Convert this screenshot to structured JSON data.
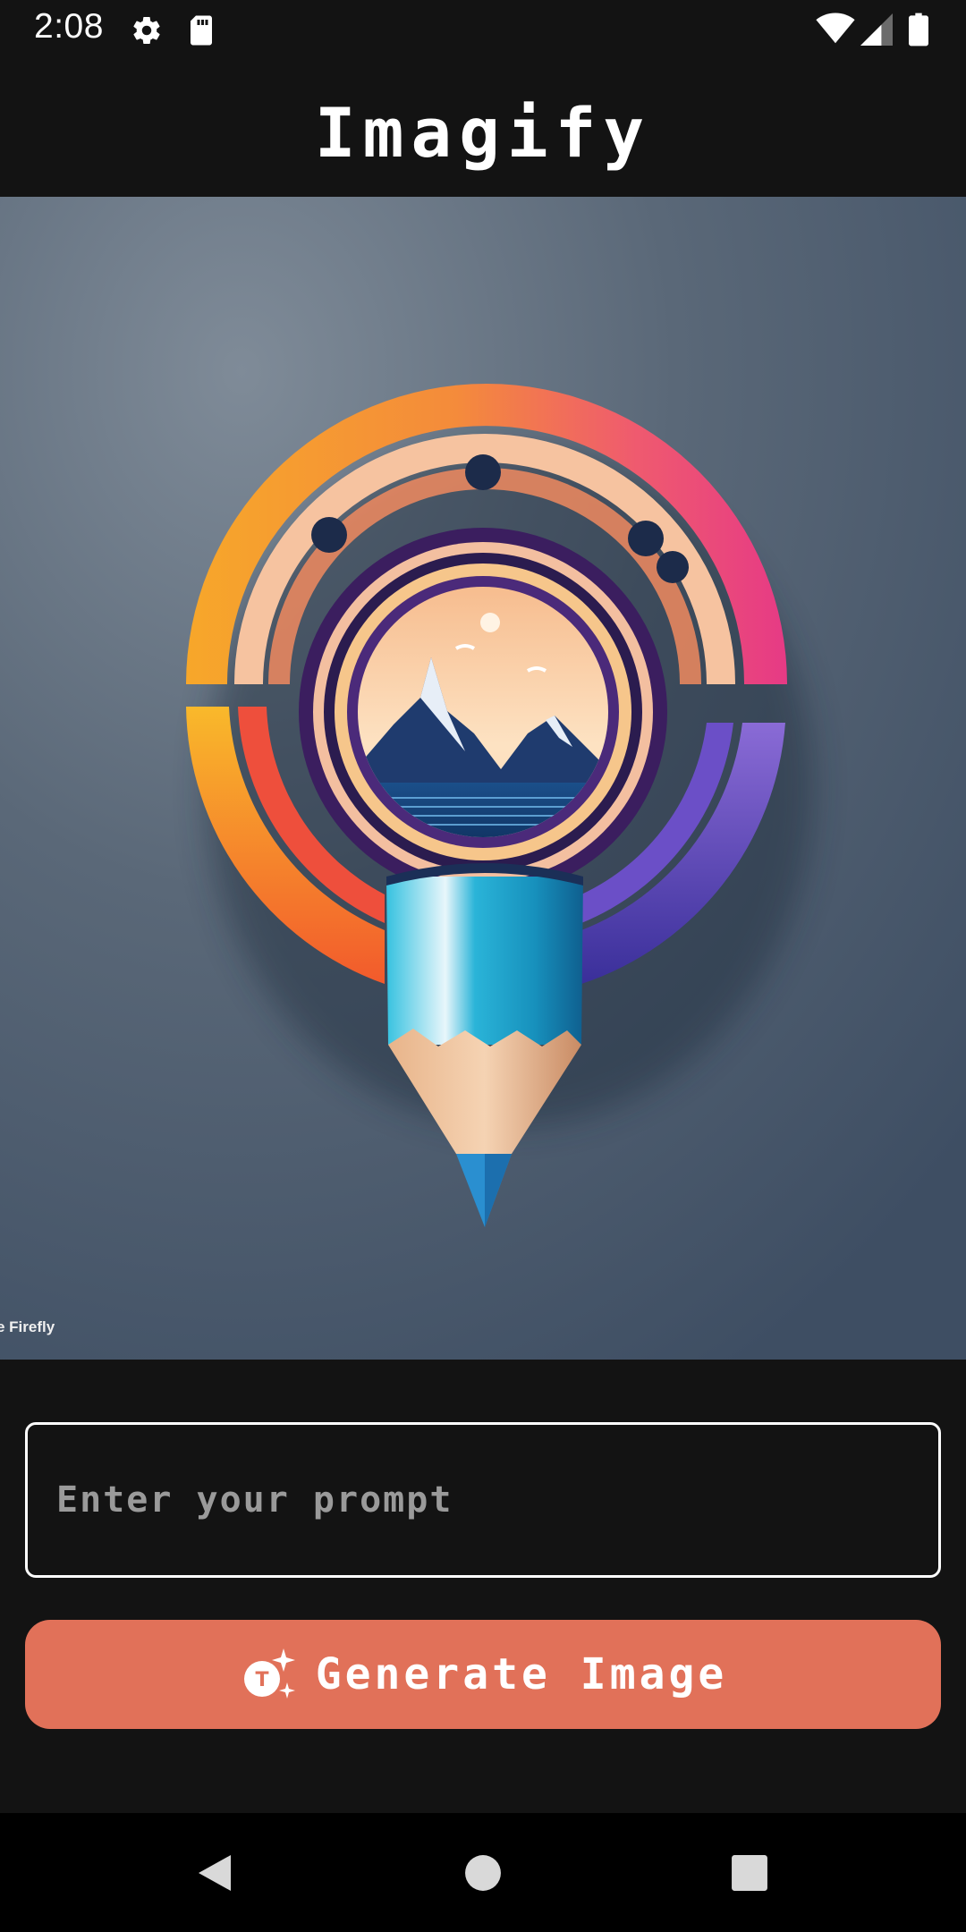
{
  "status_bar": {
    "time": "2:08",
    "icons": [
      "gear-icon",
      "sd-card-icon",
      "wifi-icon",
      "cellular-signal-icon",
      "battery-icon"
    ]
  },
  "app": {
    "title": "Imagify"
  },
  "hero_image": {
    "watermark": "e Firefly",
    "subject": "pencil-logo-illustration"
  },
  "prompt": {
    "placeholder": "Enter your prompt",
    "value": ""
  },
  "generate_button": {
    "label": "Generate Image",
    "icon": "ai-sparkle-icon"
  },
  "nav_bar": {
    "buttons": [
      "back-icon",
      "home-icon",
      "recents-icon"
    ]
  },
  "colors": {
    "background": "#131313",
    "accent": "#e17159",
    "text": "#ffffff",
    "placeholder": "#9a9a9a"
  }
}
